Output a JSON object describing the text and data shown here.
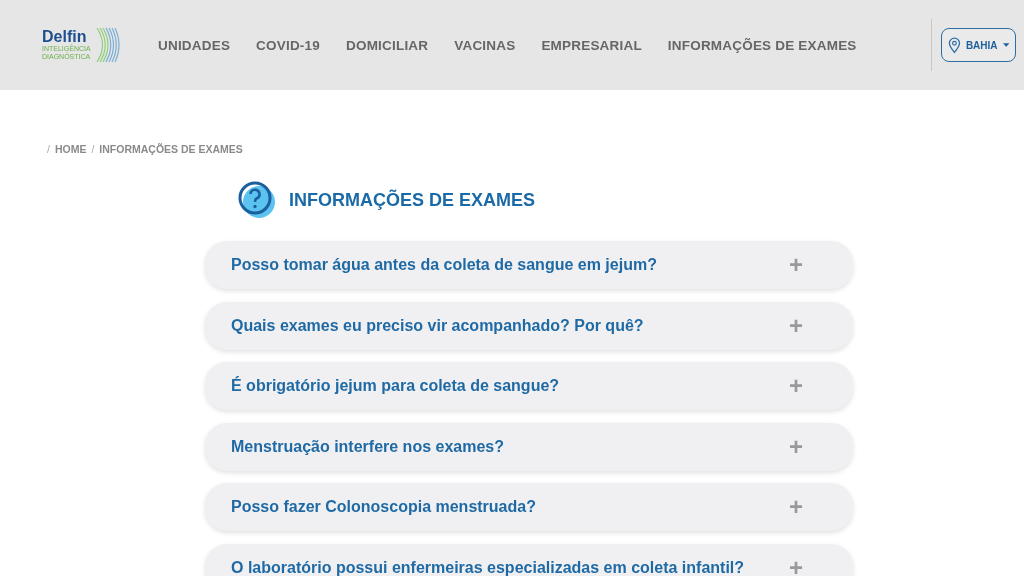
{
  "header": {
    "logo": {
      "name": "Delfin",
      "tagline_1": "INTELIGÊNCIA",
      "tagline_2": "DIAGNÓSTICA"
    },
    "nav": [
      "UNIDADES",
      "COVID-19",
      "DOMICILIAR",
      "VACINAS",
      "EMPRESARIAL",
      "INFORMAÇÕES DE EXAMES"
    ],
    "region_button": {
      "label": "BAHIA"
    }
  },
  "breadcrumb": [
    {
      "separator": "/",
      "label": "HOME"
    },
    {
      "separator": "/",
      "label": "INFORMAÇÕES DE EXAMES"
    }
  ],
  "section_title": "INFORMAÇÕES DE EXAMES",
  "faq": [
    {
      "question": "Posso tomar água antes da coleta de sangue em jejum?",
      "toggle": "+",
      "expanded": false
    },
    {
      "question": "Quais exames eu preciso vir acompanhado? Por quê?",
      "toggle": "+",
      "expanded": false
    },
    {
      "question": "É obrigatório jejum para coleta de sangue?",
      "toggle": "+",
      "expanded": false
    },
    {
      "question": "Menstruação interfere nos exames?",
      "toggle": "+",
      "expanded": false
    },
    {
      "question": "Posso fazer Colonoscopia menstruada?",
      "toggle": "+",
      "expanded": false
    },
    {
      "question": "O laboratório possui enfermeiras especializadas em coleta infantil?",
      "toggle": "+",
      "expanded": false
    }
  ]
}
